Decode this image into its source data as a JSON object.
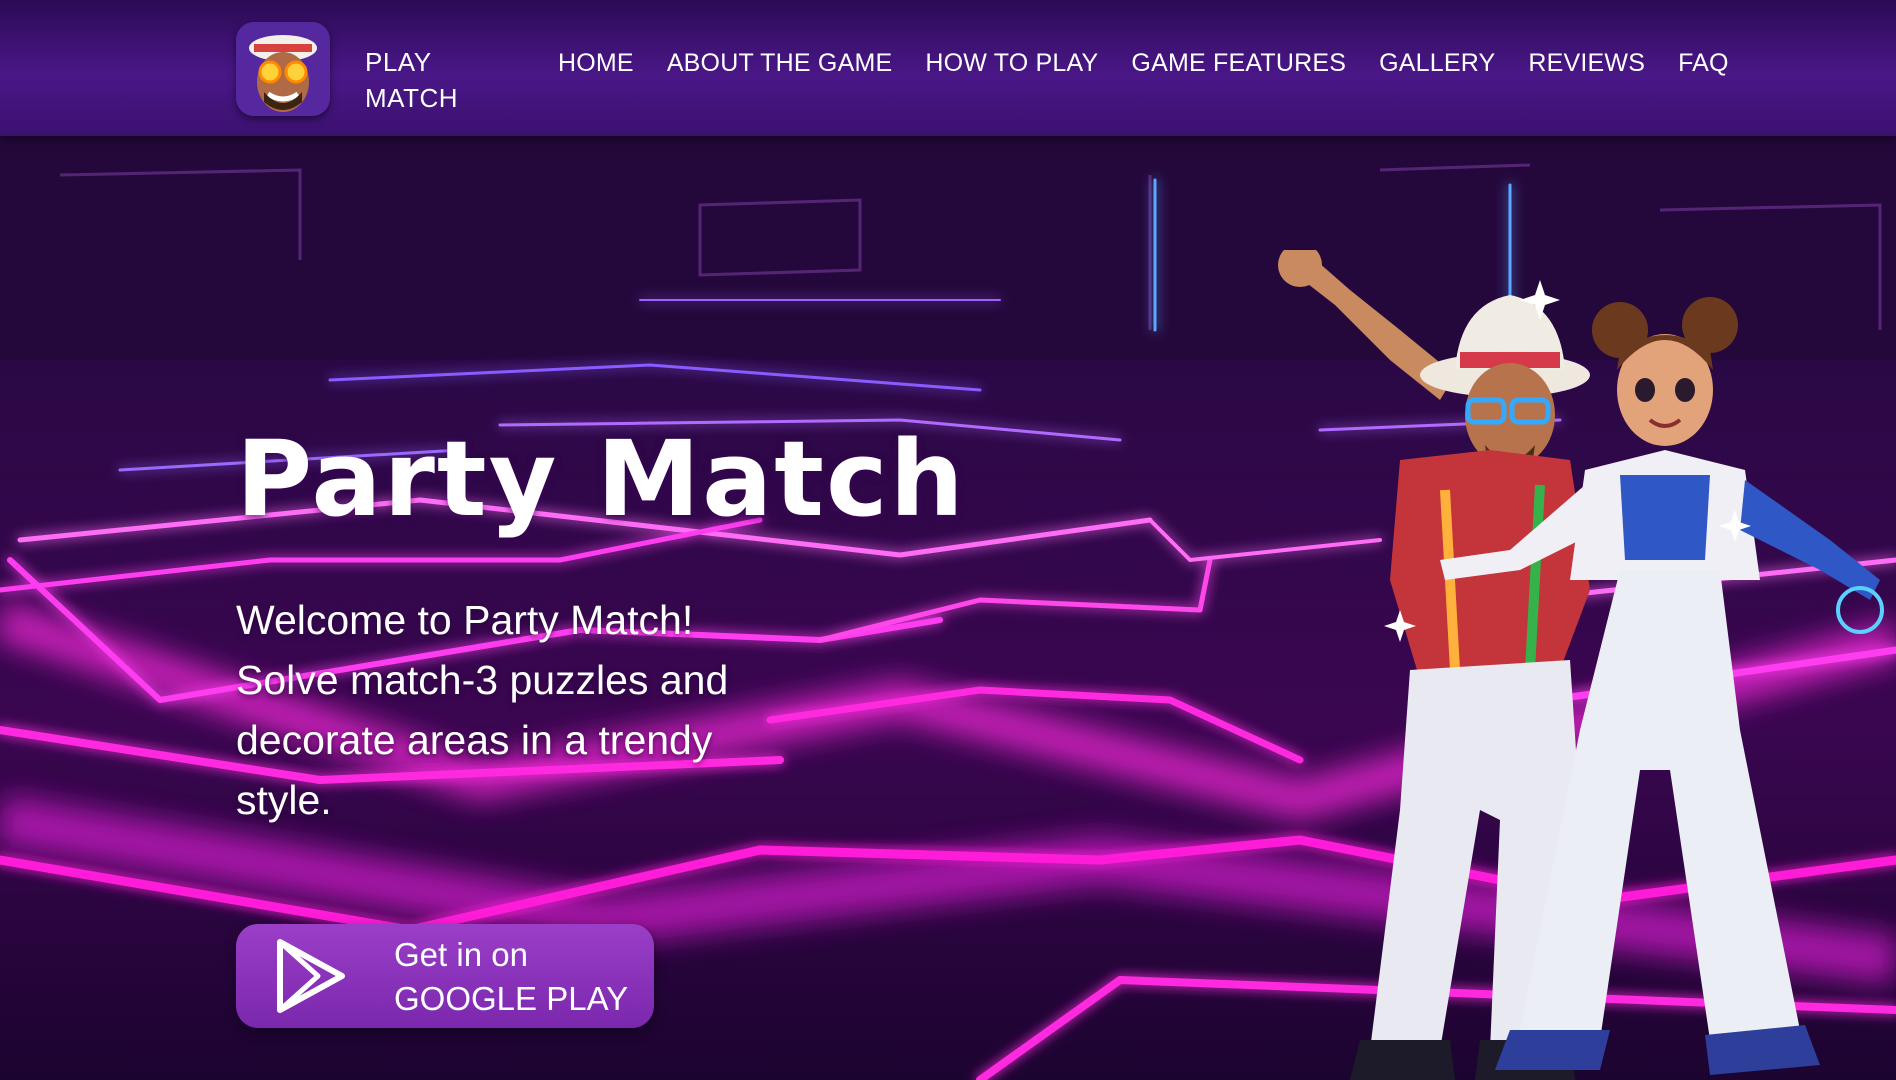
{
  "header": {
    "brand_line1": "PLAY",
    "brand_line2": "MATCH",
    "logo_icon": "character-avatar-icon",
    "nav": [
      {
        "label": "HOME"
      },
      {
        "label": "ABOUT THE GAME"
      },
      {
        "label": "HOW TO PLAY"
      },
      {
        "label": "GAME FEATURES"
      },
      {
        "label": "GALLERY"
      },
      {
        "label": "REVIEWS"
      },
      {
        "label": "FAQ"
      }
    ]
  },
  "hero": {
    "title": "Party Match",
    "description": "Welcome to Party Match! Solve match-3 puzzles and decorate areas in a trendy style.",
    "cta_line1": "Get in on",
    "cta_line2": "GOOGLE PLAY",
    "cta_icon": "google-play-icon"
  },
  "colors": {
    "header_bg": "#4a1787",
    "neon_pink": "#ff3df0",
    "neon_violet": "#8a5cff",
    "button_bg": "#8a33bb",
    "text": "#ffffff"
  }
}
